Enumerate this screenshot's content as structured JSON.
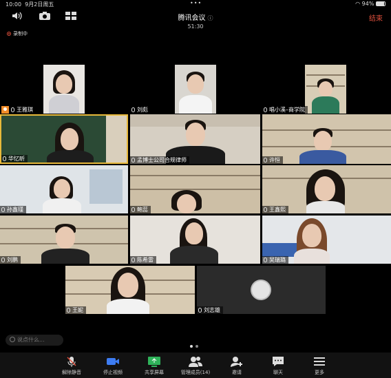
{
  "status_bar": {
    "time": "10:00",
    "date": "9月2日周五",
    "dots": "•••",
    "battery": "94%"
  },
  "header": {
    "title": "腾讯会议",
    "timer": "51:30",
    "end_label": "结束"
  },
  "recording": {
    "label": "录制中"
  },
  "participants": [
    {
      "name": "王雅琪",
      "host": true
    },
    {
      "name": "刘彪"
    },
    {
      "name": "唱小溪–商学院"
    },
    {
      "name": "华忆昕"
    },
    {
      "name": "孟博士公司合规律师"
    },
    {
      "name": "许恒"
    },
    {
      "name": "孙鑫瑾"
    },
    {
      "name": "鲍蕊"
    },
    {
      "name": "王鑫熙"
    },
    {
      "name": "刘鹏"
    },
    {
      "name": "陈希雷"
    },
    {
      "name": "吴瑞璐"
    },
    {
      "name": "王妮"
    },
    {
      "name": "刘志雄"
    }
  ],
  "chat": {
    "placeholder": "说点什么..."
  },
  "toolbar": {
    "items": [
      {
        "label": "解除静音",
        "icon": "mic-muted-icon"
      },
      {
        "label": "停止视频",
        "icon": "video-camera-icon",
        "color": "#3d7cf2"
      },
      {
        "label": "共享屏幕",
        "icon": "share-screen-icon",
        "color": "#2fb35a"
      },
      {
        "label": "管理成员(14)",
        "icon": "members-icon"
      },
      {
        "label": "邀请",
        "icon": "invite-icon"
      },
      {
        "label": "聊天",
        "icon": "chat-icon"
      },
      {
        "label": "更多",
        "icon": "more-icon"
      }
    ]
  }
}
